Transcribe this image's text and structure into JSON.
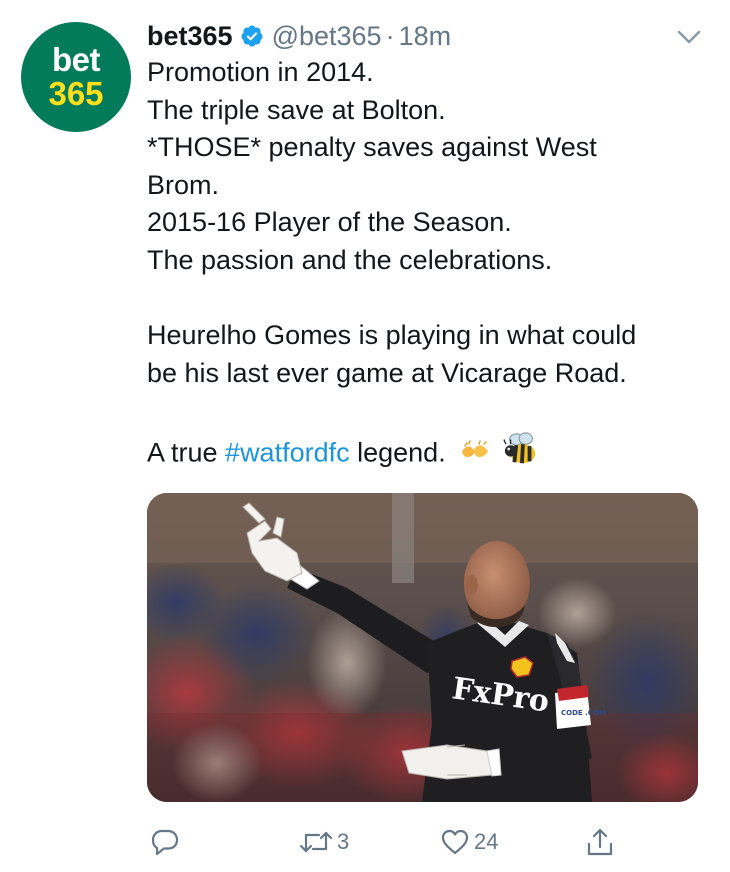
{
  "author": {
    "avatar_line1": "bet",
    "avatar_line2": "365",
    "display_name": "bet365",
    "handle": "@bet365",
    "separator": "·",
    "time": "18m",
    "verified_icon": "verified-badge-icon"
  },
  "tweet": {
    "lines": [
      "Promotion in 2014.",
      "The triple save at Bolton.",
      "*THOSE* penalty saves against West",
      "Brom.",
      "2015-16 Player of the Season.",
      "The passion and the celebrations."
    ],
    "paragraph2_lines": [
      "Heurelho Gomes is playing in what could",
      "be his last ever game at Vicarage Road."
    ],
    "closing_prefix": "A true ",
    "hashtag": "#watfordfc",
    "closing_suffix": " legend.",
    "emojis": [
      "clapping-hands-icon",
      "bee-icon"
    ]
  },
  "media": {
    "sponsor_text": "FxPro",
    "armband_text": "CODE .COM"
  },
  "actions": {
    "reply_count": "",
    "retweet_count": "3",
    "like_count": "24"
  },
  "colors": {
    "avatar_bg": "#027b5b",
    "avatar_text_1": "#ffffff",
    "avatar_text_2": "#ffdf1b",
    "hashtag": "#1b95e0",
    "muted": "#657786",
    "verified": "#1da1f2"
  }
}
